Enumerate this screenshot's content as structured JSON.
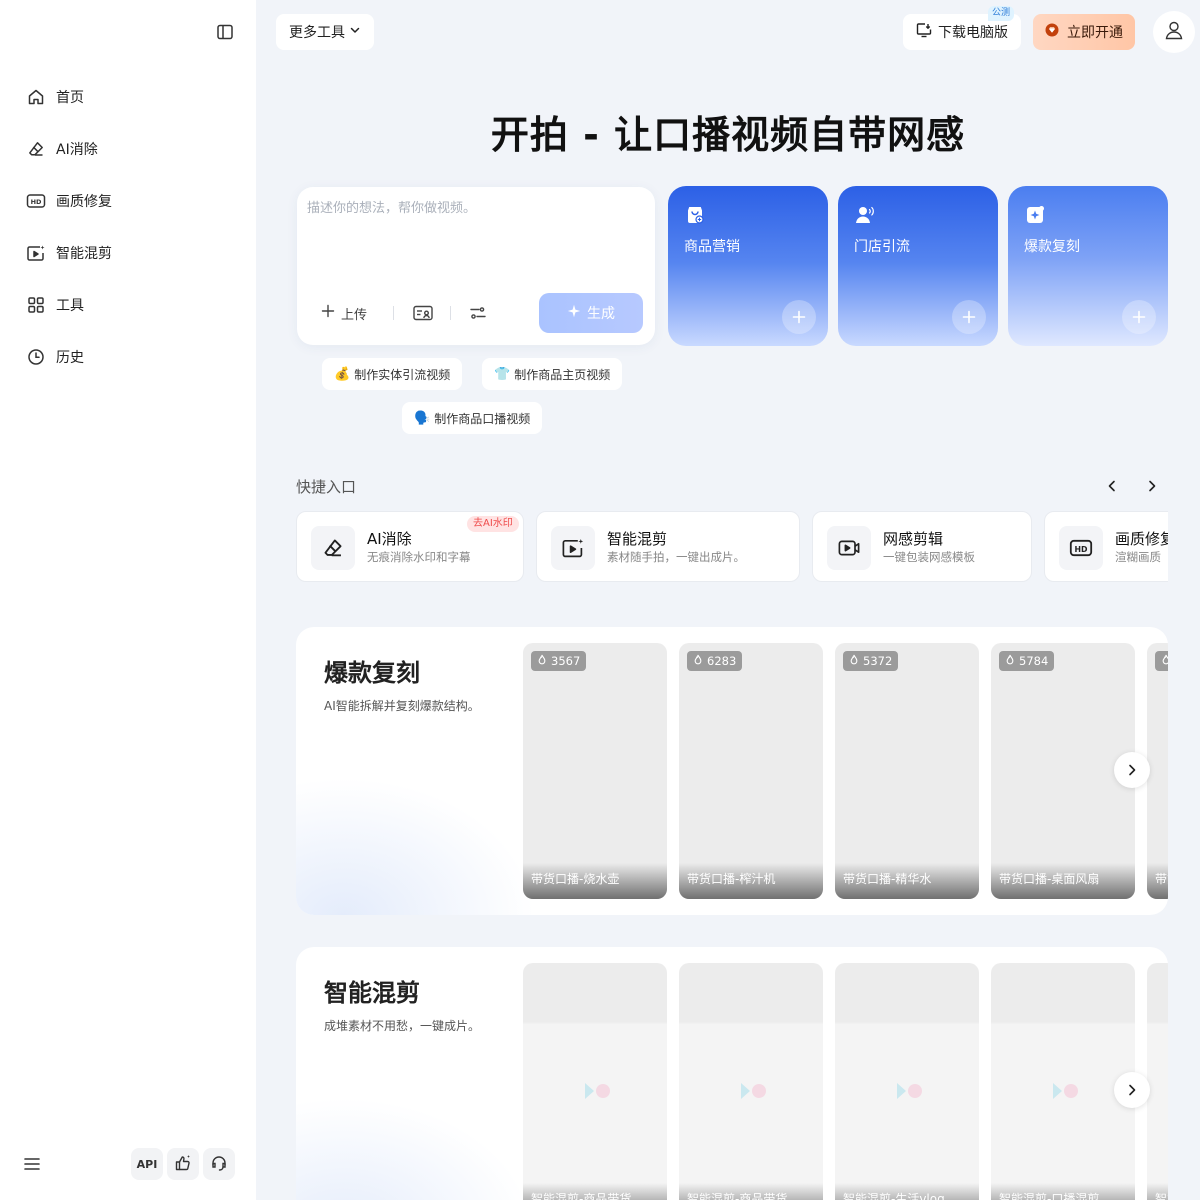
{
  "sidebar": {
    "items": [
      {
        "label": "首页",
        "icon": "home-icon"
      },
      {
        "label": "AI消除",
        "icon": "eraser-icon"
      },
      {
        "label": "画质修复",
        "icon": "hd-icon"
      },
      {
        "label": "智能混剪",
        "icon": "smart-clip-icon"
      },
      {
        "label": "工具",
        "icon": "grid-icon"
      },
      {
        "label": "历史",
        "icon": "clock-icon"
      }
    ],
    "api_label": "API"
  },
  "topbar": {
    "more_tools": "更多工具",
    "download": "下载电脑版",
    "beta_badge": "公测",
    "vip": "立即开通"
  },
  "hero": {
    "title": "开拍 - 让口播视频自带网感",
    "prompt_placeholder": "描述你的想法，帮你做视频。",
    "upload_label": "上传",
    "generate_label": "生成"
  },
  "scene_cards": [
    {
      "label": "商品营销"
    },
    {
      "label": "门店引流"
    },
    {
      "label": "爆款复刻"
    }
  ],
  "suggestions": [
    {
      "emoji": "💰",
      "text": "制作实体引流视频"
    },
    {
      "emoji": "👕",
      "text": "制作商品主页视频"
    },
    {
      "emoji": "🗣️",
      "text": "制作商品口播视频"
    }
  ],
  "quick_entry": {
    "title": "快捷入口",
    "items": [
      {
        "name": "AI消除",
        "desc": "无痕消除水印和字幕",
        "tag": "去AI水印"
      },
      {
        "name": "智能混剪",
        "desc": "素材随手拍，一键出成片。",
        "tag": ""
      },
      {
        "name": "网感剪辑",
        "desc": "一键包装网感模板",
        "tag": ""
      },
      {
        "name": "画质修复",
        "desc": "渲糊画质",
        "tag": ""
      }
    ]
  },
  "sections": [
    {
      "title": "爆款复刻",
      "subtitle": "AI智能拆解并复刻爆款结构。",
      "cards": [
        {
          "count": "3567",
          "title": "带货口播-烧水壶"
        },
        {
          "count": "6283",
          "title": "带货口播-榨汁机"
        },
        {
          "count": "5372",
          "title": "带货口播-精华水"
        },
        {
          "count": "5784",
          "title": "带货口播-桌面风扇"
        },
        {
          "count": "",
          "title": "带货"
        }
      ]
    },
    {
      "title": "智能混剪",
      "subtitle": "成堆素材不用愁，一键成片。",
      "cards": [
        {
          "count": "",
          "title": "智能混剪-商品带货"
        },
        {
          "count": "",
          "title": "智能混剪-商品带货"
        },
        {
          "count": "",
          "title": "智能混剪-生活vlog"
        },
        {
          "count": "",
          "title": "智能混剪-口播混剪"
        },
        {
          "count": "",
          "title": "智能"
        }
      ]
    }
  ],
  "colors": {
    "accent": "#3b6cf0",
    "scene_gradient_top": "#2f63e8",
    "scene_gradient_bottom": "#c8d8ff",
    "vip_bg": "#ffc6a6",
    "generate_bg": "#aac3ff"
  }
}
